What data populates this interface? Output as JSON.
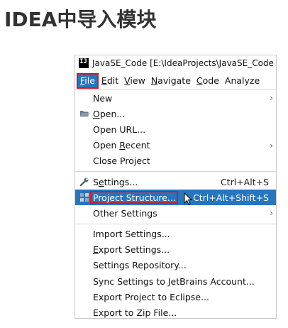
{
  "page": {
    "title": "IDEA中导入模块"
  },
  "window": {
    "app_icon_text": "IJ",
    "title": "JavaSE_Code [E:\\IdeaProjects\\JavaSE_Code"
  },
  "menubar": {
    "items": [
      {
        "label_u": "F",
        "label_rest": "ile"
      },
      {
        "label_u": "E",
        "label_rest": "dit"
      },
      {
        "label_u": "V",
        "label_rest": "iew"
      },
      {
        "label_u": "N",
        "label_rest": "avigate"
      },
      {
        "label_u": "C",
        "label_rest": "ode"
      },
      {
        "label_u": "",
        "label_rest": "Analyze"
      }
    ]
  },
  "file_menu": {
    "new": "New",
    "open_u": "O",
    "open_rest": "pen...",
    "open_url": "Open URL...",
    "open_recent_pre": "Open ",
    "open_recent_u": "R",
    "open_recent_rest": "ecent",
    "close_project": "Close Project",
    "settings_pre": "S",
    "settings_u": "e",
    "settings_rest": "ttings...",
    "settings_shortcut": "Ctrl+Alt+S",
    "project_structure": "Project Structure...",
    "project_structure_shortcut": "Ctrl+Alt+Shift+S",
    "other_settings": "Other Settings",
    "import_settings": "Import Settings...",
    "export_settings_u": "E",
    "export_settings_rest": "xport Settings...",
    "settings_repository": "Settings Repository...",
    "sync_settings": "Sync Settings to JetBrains Account...",
    "export_eclipse": "Export Project to Eclipse...",
    "export_zip": "Export to Zip File..."
  },
  "colors": {
    "selection": "#2675bf",
    "highlight_box": "#e0141e"
  }
}
